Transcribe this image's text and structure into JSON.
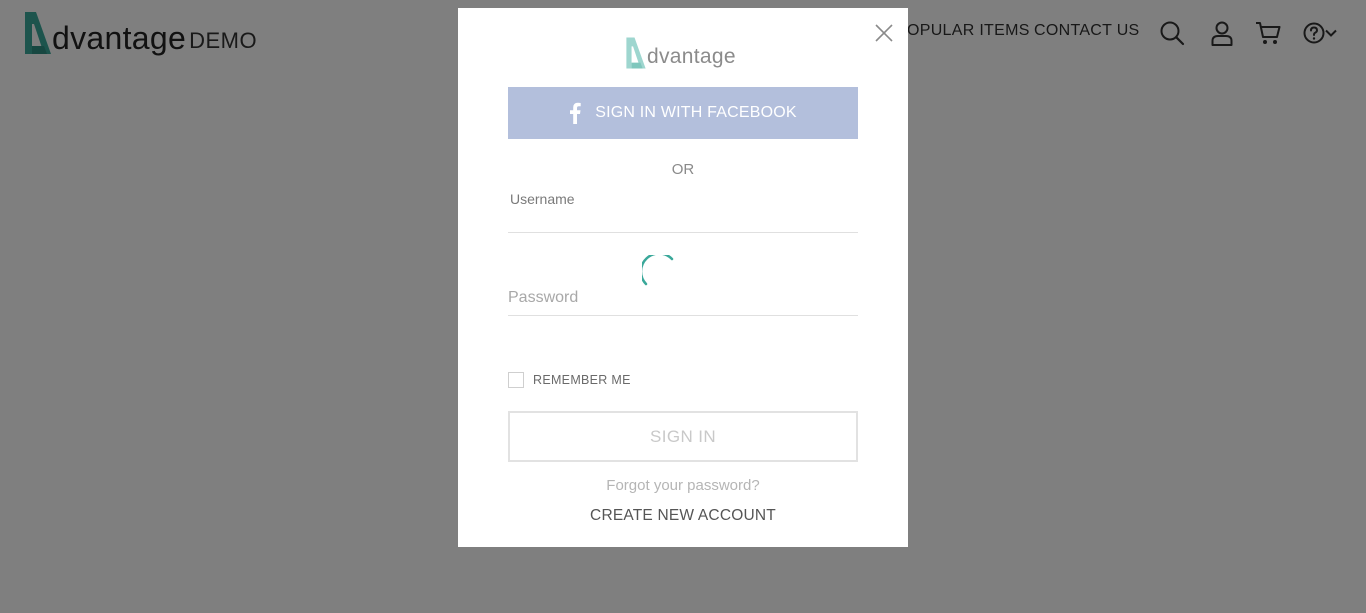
{
  "header": {
    "brand_name": "dvantage",
    "brand_suffix": "DEMO",
    "nav": [
      {
        "label": "POPULAR ITEMS"
      },
      {
        "label": "CONTACT US"
      }
    ],
    "icons": [
      "search-icon",
      "user-icon",
      "cart-icon",
      "help-icon",
      "chevron-down-icon"
    ]
  },
  "colors": {
    "brand_teal": "#3aa89a",
    "facebook_button": "#b3bfdc",
    "overlay": "rgba(0,0,0,0.5)"
  },
  "modal": {
    "logo_word": "dvantage",
    "facebook_label": "SIGN IN WITH FACEBOOK",
    "or_label": "OR",
    "username": {
      "label": "Username",
      "value": ""
    },
    "password": {
      "placeholder": "Password",
      "value": ""
    },
    "remember_label": "REMEMBER ME",
    "remember_checked": false,
    "signin_label": "SIGN IN",
    "forgot_label": "Forgot your password?",
    "create_label": "CREATE NEW ACCOUNT"
  }
}
